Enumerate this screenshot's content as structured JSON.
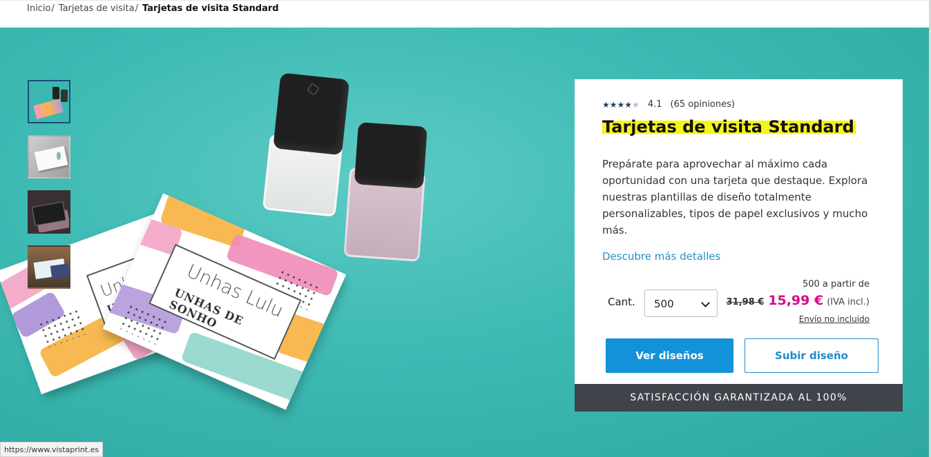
{
  "breadcrumb": {
    "items": [
      "Inicio",
      "Tarjetas de visita"
    ],
    "separator": "/",
    "current": "Tarjetas de visita Standard"
  },
  "gallery": {
    "thumbnails": [
      "thumbnail-1",
      "thumbnail-2",
      "thumbnail-3",
      "thumbnail-4"
    ],
    "active_index": 0,
    "photo_text": {
      "front_name": "Unhas Lulu",
      "front_sub": "UNHAS DE SONHO",
      "back_name": "Unhas",
      "back_sub": "UNHAS"
    }
  },
  "product": {
    "rating": {
      "stars": 4.1,
      "value": "4.1",
      "count": "(65 opiniones)"
    },
    "title": "Tarjetas de visita Standard",
    "description": "Prepárate para aprovechar al máximo cada oportunidad con una tarjeta que destaque. Explora nuestras plantillas de diseño totalmente personalizables, tipos de papel exclusivos y mucho más.",
    "details_link": "Descubre más detalles",
    "quantity": {
      "label": "Cant.",
      "value": "500"
    },
    "price": {
      "from": "500 a partir de",
      "old": "31,98 €",
      "new": "15,99 €",
      "tax": "(IVA incl.)",
      "shipping": "Envío no incluido"
    },
    "buttons": {
      "primary": "Ver diseños",
      "secondary": "Subir diseño"
    },
    "guarantee": "SATISFACCIÓN GARANTIZADA AL 100%"
  },
  "status_bar": {
    "url": "https://www.vistaprint.es"
  },
  "colors": {
    "hero_bg": "#3dbab3",
    "accent_blue": "#1391d9",
    "price_magenta": "#d90a8c",
    "highlight_yellow": "#f5f51a",
    "guarantee_bg": "#3e444a",
    "star_color": "#1f3f66"
  }
}
